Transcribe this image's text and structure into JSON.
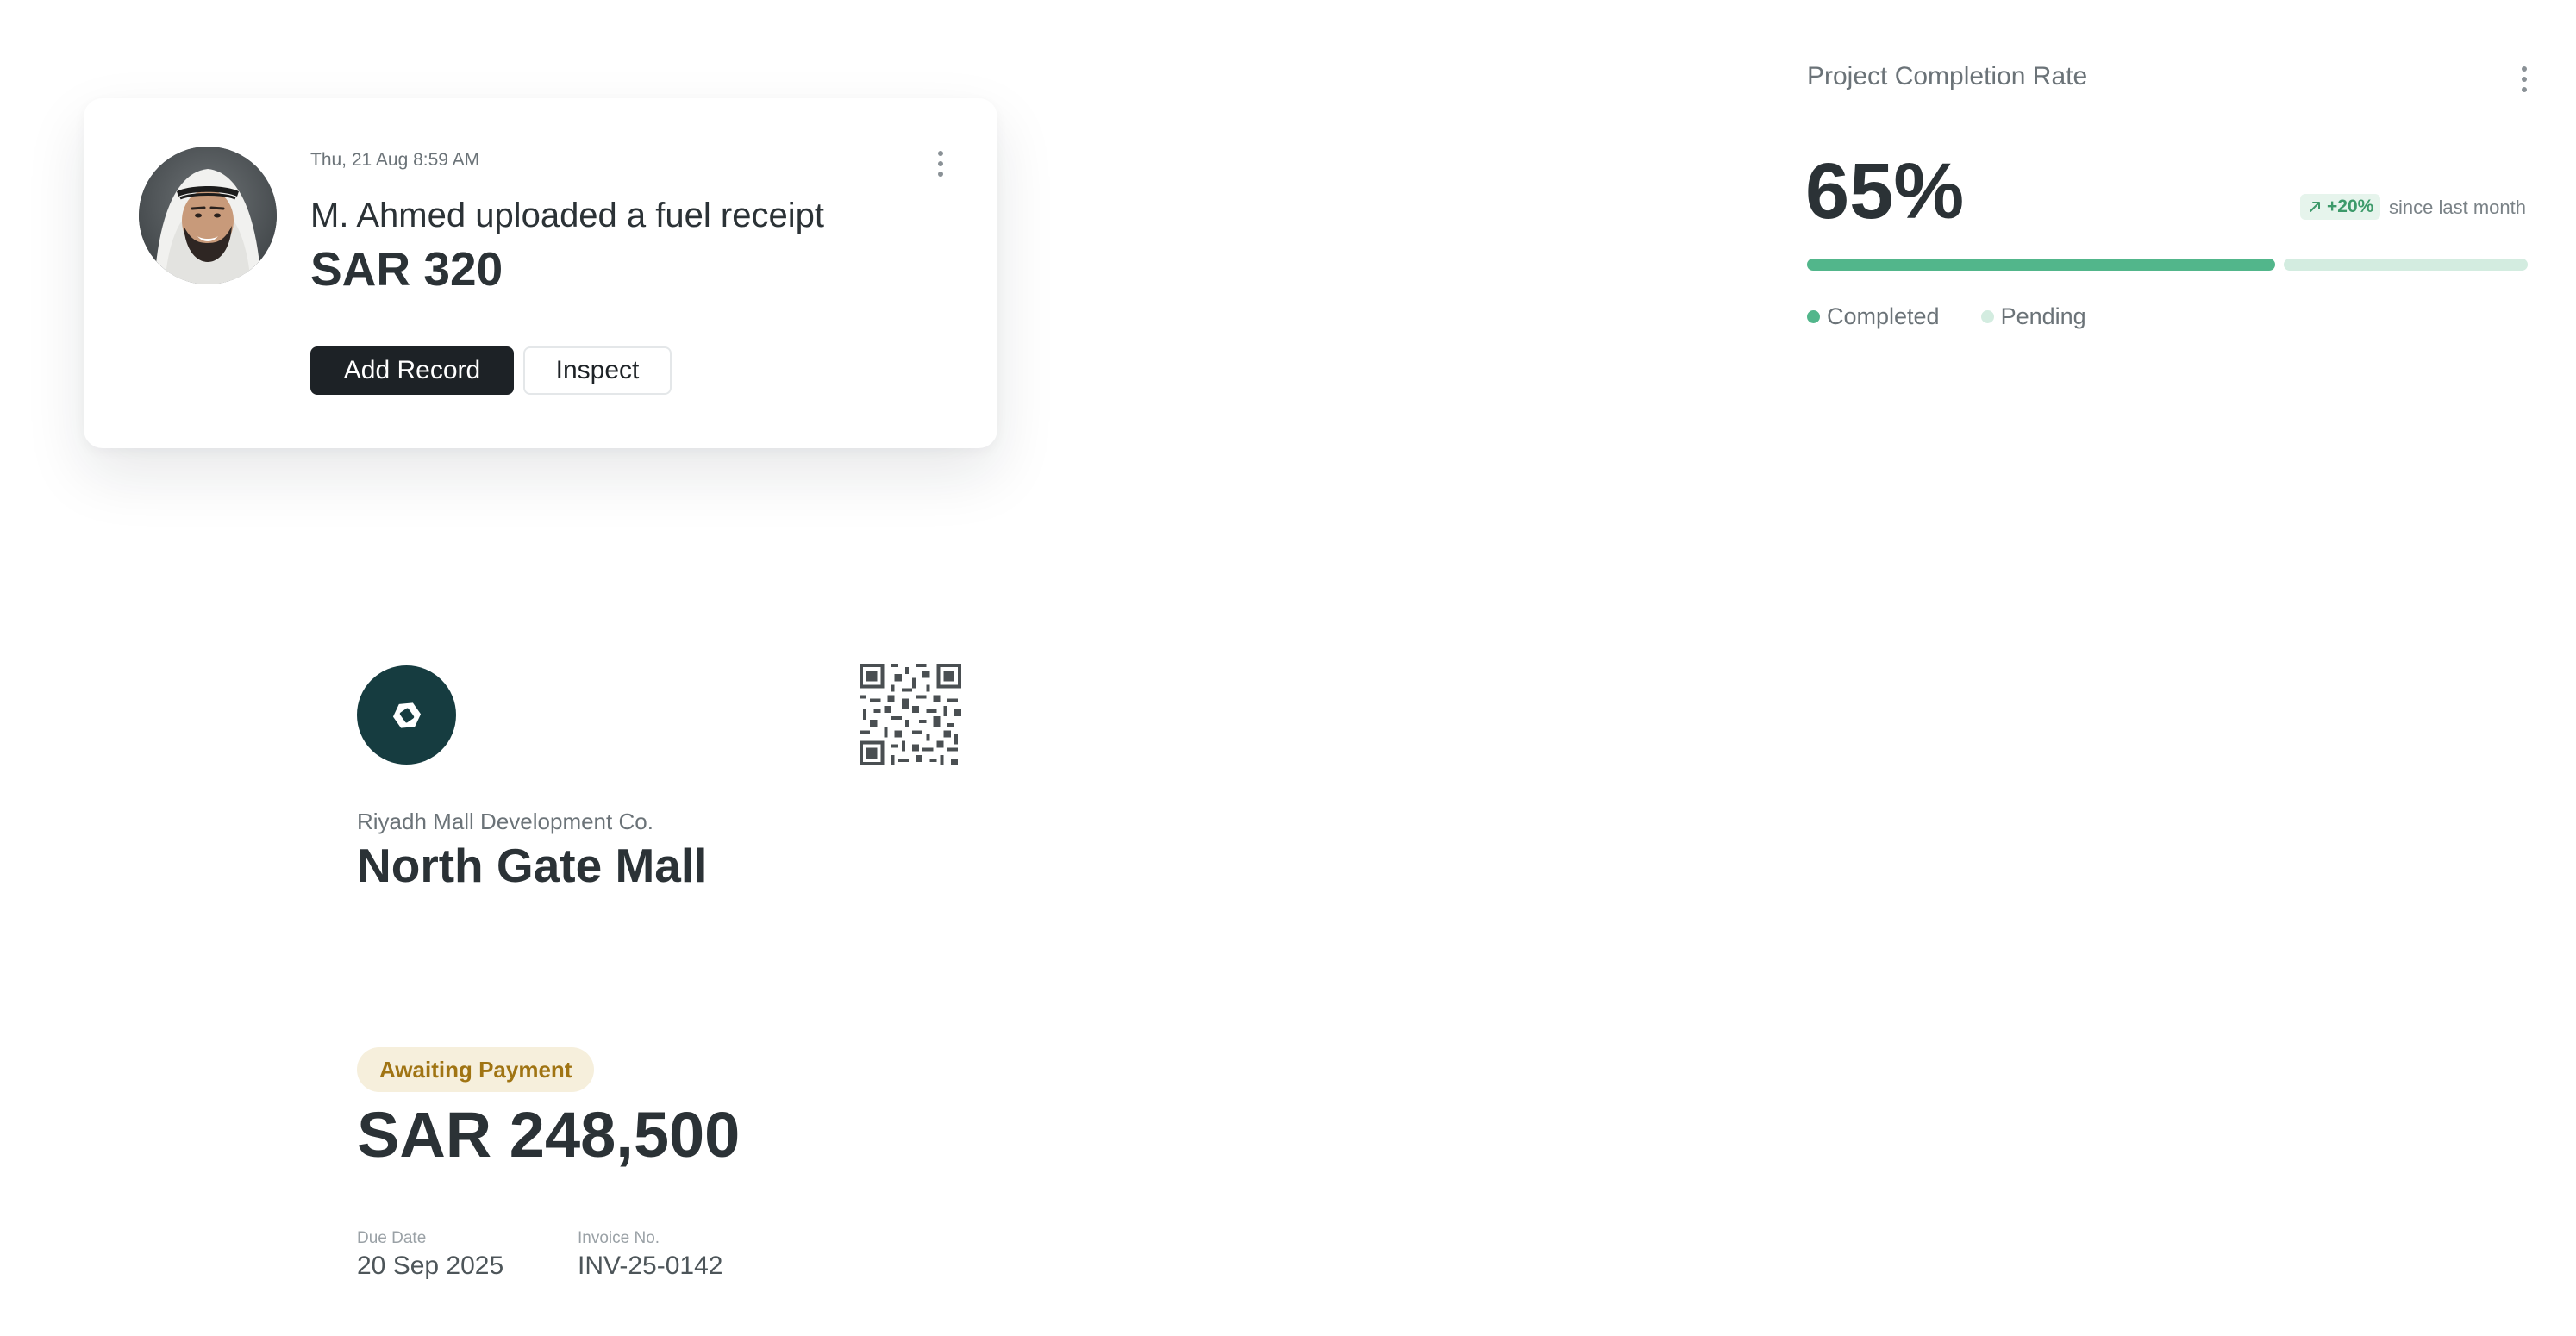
{
  "activity": {
    "timestamp": "Thu, 21 Aug 8:59 AM",
    "message": "M. Ahmed uploaded a fuel receipt",
    "amount": "SAR 320",
    "primary_action": "Add Record",
    "secondary_action": "Inspect",
    "menu_icon": "more-vertical-icon"
  },
  "completion": {
    "title": "Project Completion Rate",
    "value": "65%",
    "progress_fraction": 0.65,
    "trend": "+20%",
    "trend_icon": "arrow-up-right-icon",
    "trend_caption": "since last month",
    "legend": [
      {
        "label": "Completed",
        "color": "#52b68b"
      },
      {
        "label": "Pending",
        "color": "#d3ece0"
      }
    ],
    "menu_icon": "more-vertical-icon"
  },
  "invoice": {
    "logo_icon": "company-logo-icon",
    "qr_icon": "qr-code-icon",
    "company": "Riyadh Mall Development Co.",
    "project": "North Gate Mall",
    "status": "Awaiting Payment",
    "amount": "SAR 248,500",
    "due_date_label": "Due Date",
    "due_date": "20 Sep 2025",
    "invoice_no_label": "Invoice No.",
    "invoice_no": "INV-25-0142"
  },
  "colors": {
    "primary_button": "#1d2226",
    "progress_complete": "#52b68b",
    "progress_pending": "#d3ece0",
    "trend_positive": "#3d9a6a",
    "status_awaiting": "#a07413",
    "logo_bg": "#163c40"
  }
}
